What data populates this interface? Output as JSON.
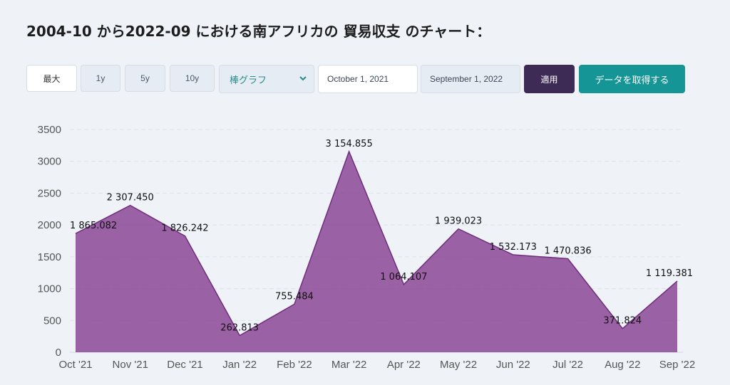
{
  "title": "2004-10 から2022-09 における南アフリカの 貿易収支 のチャート：",
  "toolbar": {
    "ranges": [
      "最大",
      "1y",
      "5y",
      "10y"
    ],
    "chart_type_selected": "棒グラフ",
    "date_from": "October 1, 2021",
    "date_to": "September 1, 2022",
    "apply_label": "適用",
    "get_data_label": "データを取得する",
    "colors": {
      "apply": "#3d2a55",
      "get_data": "#159595"
    }
  },
  "chart_data": {
    "type": "area",
    "categories": [
      "Oct '21",
      "Nov '21",
      "Dec '21",
      "Jan '22",
      "Feb '22",
      "Mar '22",
      "Apr '22",
      "May '22",
      "Jun '22",
      "Jul '22",
      "Aug '22",
      "Sep '22"
    ],
    "values": [
      1865.082,
      2307.45,
      1826.242,
      262.813,
      755.484,
      3154.855,
      1064.107,
      1939.023,
      1532.173,
      1470.836,
      371.824,
      1119.381
    ],
    "value_labels": [
      "1 865.082",
      "2 307.450",
      "1 826.242",
      "262.813",
      "755.484",
      "3 154.855",
      "1 064.107",
      "1 939.023",
      "1 532.173",
      "1 470.836",
      "371.824",
      "1 119.381"
    ],
    "yticks": [
      "0",
      "500",
      "1000",
      "1500",
      "2000",
      "2500",
      "3000",
      "3500"
    ],
    "ylim": [
      0,
      3500
    ],
    "grid": true,
    "color": "#8c4796"
  }
}
